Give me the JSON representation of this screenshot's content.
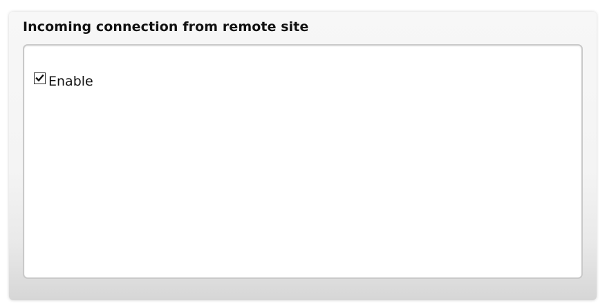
{
  "section": {
    "title": "Incoming connection from remote site",
    "enable_checkbox": {
      "label": "Enable",
      "checked": true
    }
  },
  "icons": {
    "checkbox_mark": "check-mark-icon"
  }
}
